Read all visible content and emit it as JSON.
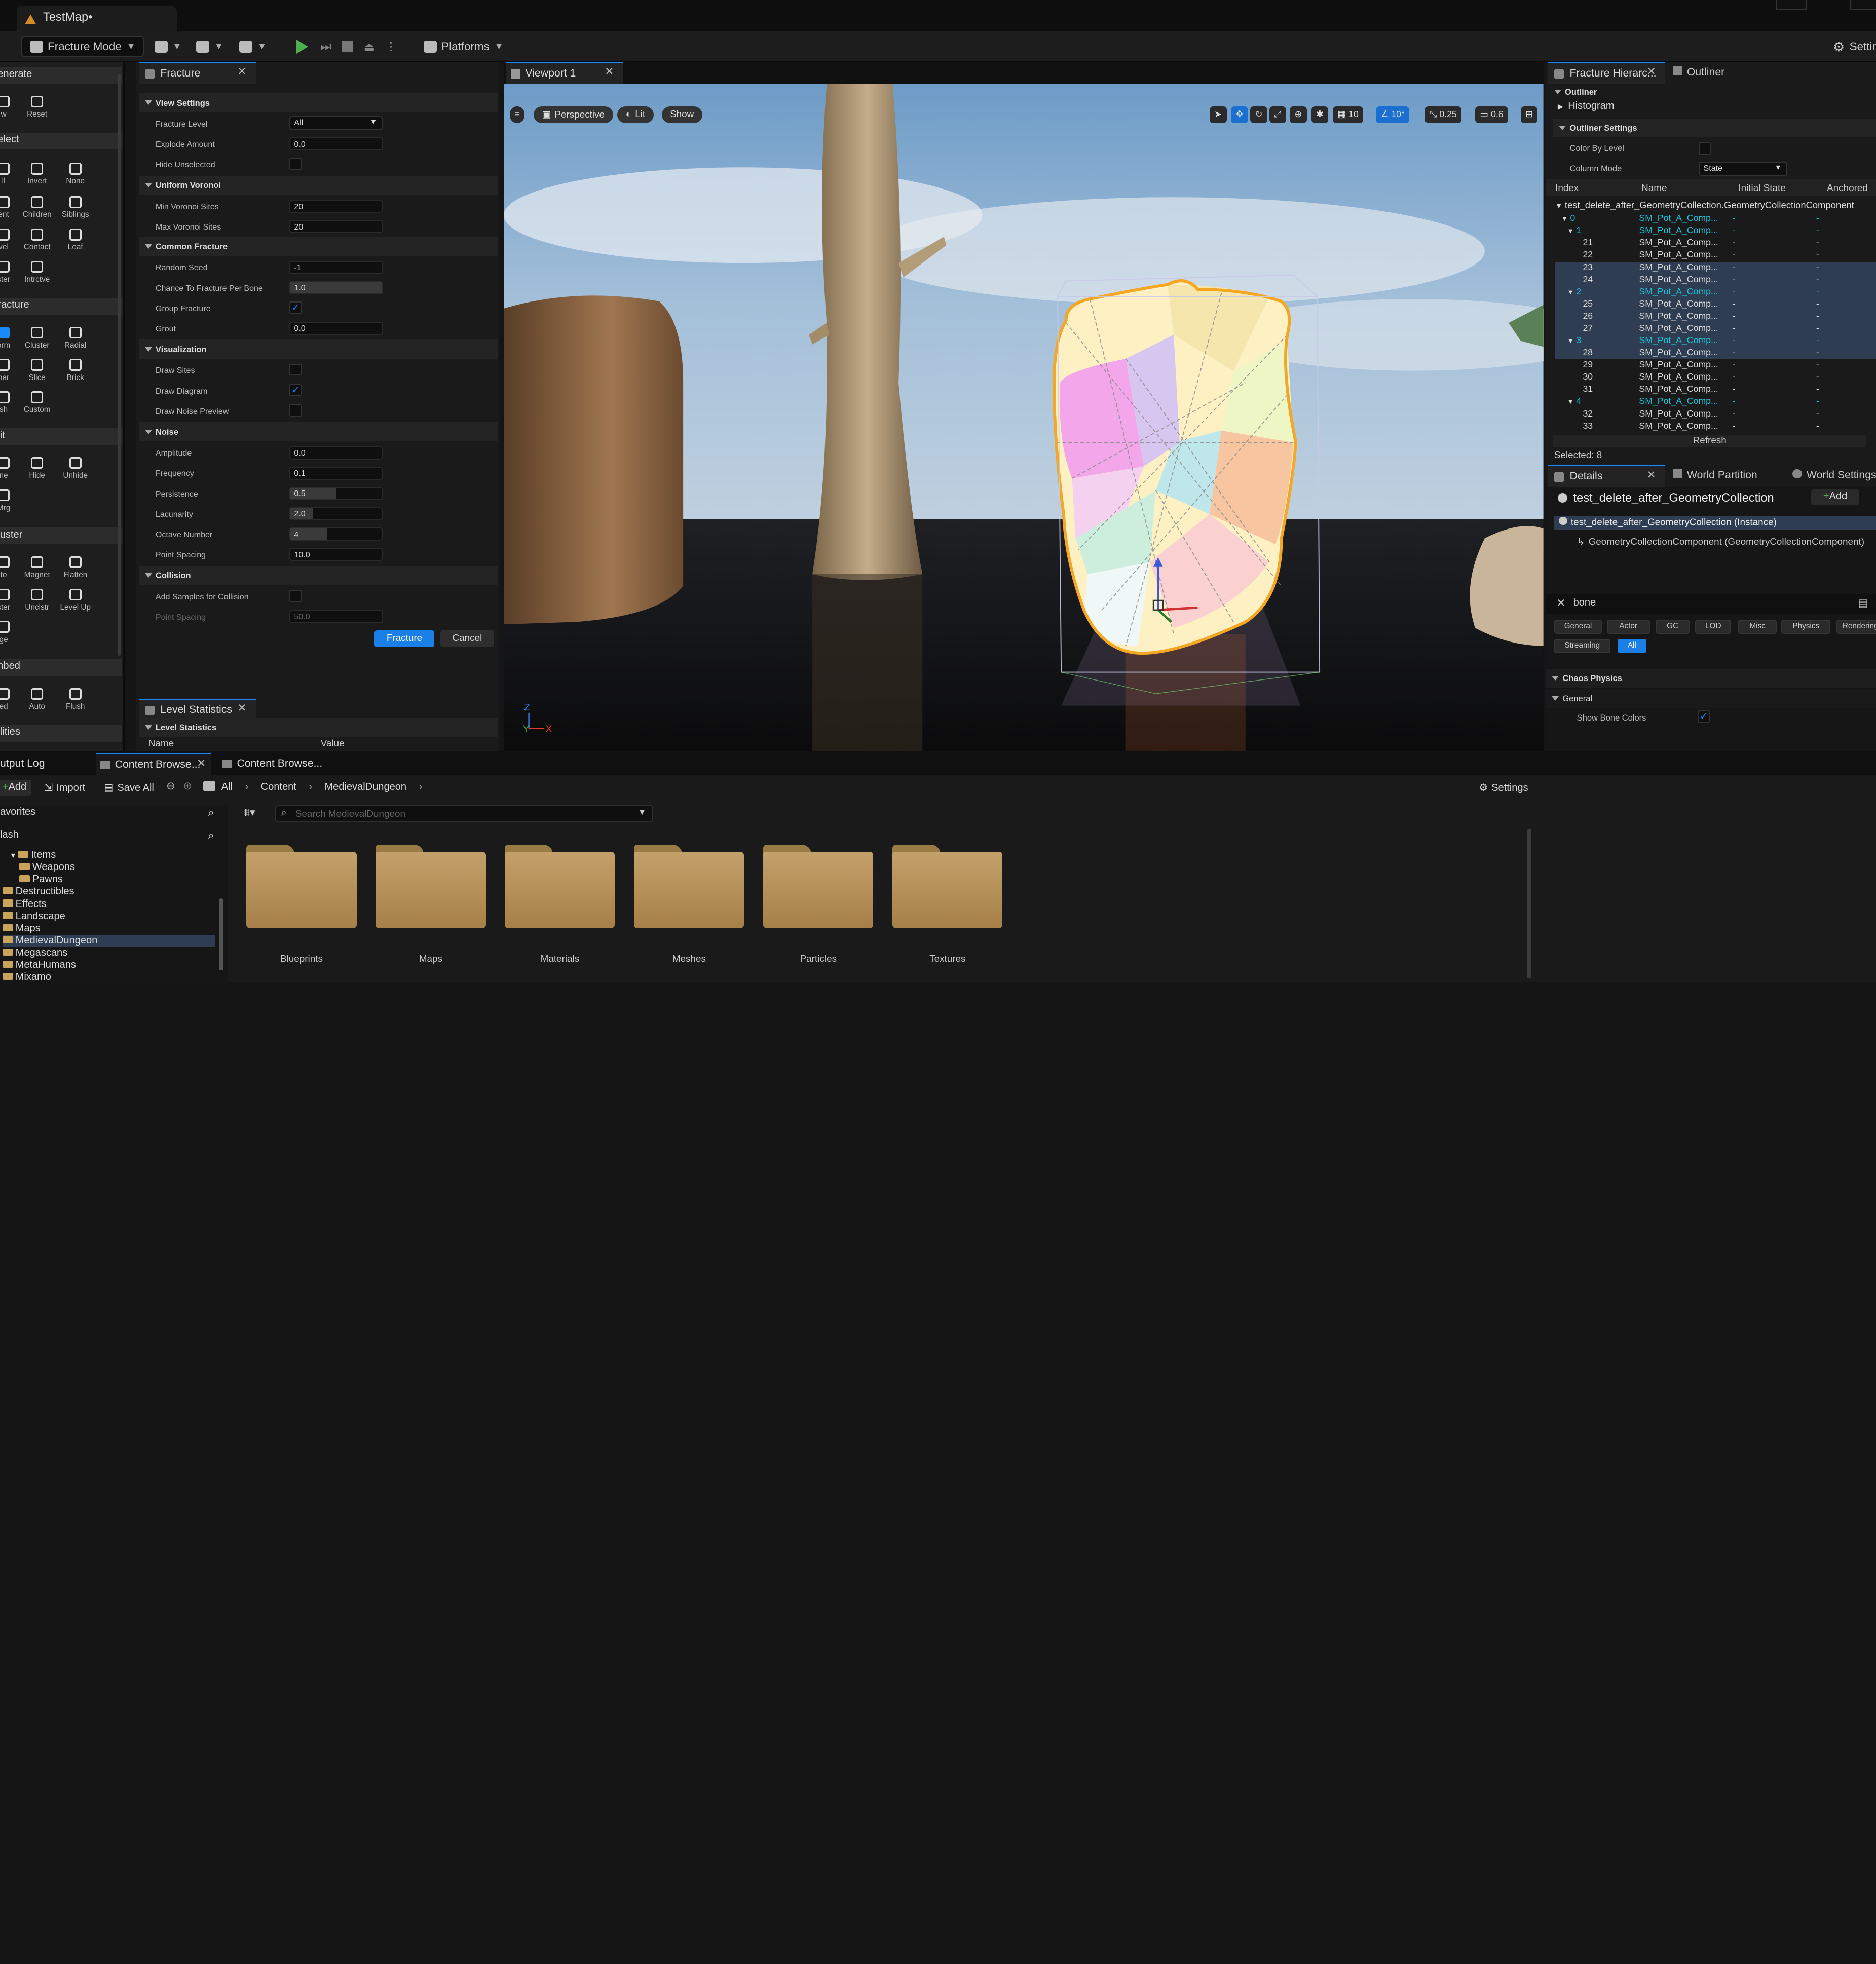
{
  "title_bar": {
    "map_tab": "TestMap•"
  },
  "toolbar": {
    "mode_label": "Fracture Mode",
    "platforms_label": "Platforms",
    "settings_label": "Settings"
  },
  "palette": {
    "sections": [
      "enerate",
      "elect",
      "racture",
      "lit",
      "luster",
      "nbed",
      "ilities"
    ],
    "generate_buttons": [
      "w",
      "Reset"
    ],
    "select_buttons": [
      "ll",
      "Invert",
      "None",
      "ent",
      "Children",
      "Siblings",
      "vel",
      "Contact",
      "Leaf",
      "ster",
      "Intrctve"
    ],
    "fracture_buttons": [
      "orm",
      "Cluster",
      "Radial",
      "nar",
      "Slice",
      "Brick",
      "sh",
      "Custom"
    ],
    "edit_buttons": [
      "ne",
      "Hide",
      "Unhide",
      "Mrg"
    ],
    "cluster_buttons": [
      "to",
      "Magnet",
      "Flatten",
      "ster",
      "Unclstr",
      "Level Up",
      "ge"
    ],
    "embed_buttons": [
      "ed",
      "Auto",
      "Flush"
    ]
  },
  "fracture_panel": {
    "tab": "Fracture",
    "sections": {
      "view": "View Settings",
      "voronoi": "Uniform Voronoi",
      "common": "Common Fracture",
      "visualization": "Visualization",
      "noise": "Noise",
      "collision": "Collision"
    },
    "rows": {
      "fracture_level": {
        "label": "Fracture Level",
        "value": "All"
      },
      "explode_amount": {
        "label": "Explode Amount",
        "value": "0.0"
      },
      "hide_unselected": {
        "label": "Hide Unselected"
      },
      "min_voronoi": {
        "label": "Min Voronoi Sites",
        "value": "20"
      },
      "max_voronoi": {
        "label": "Max Voronoi Sites",
        "value": "20"
      },
      "random_seed": {
        "label": "Random Seed",
        "value": "-1"
      },
      "chance": {
        "label": "Chance To Fracture Per Bone",
        "value": "1.0"
      },
      "group_fracture": {
        "label": "Group Fracture",
        "checked": true
      },
      "grout": {
        "label": "Grout",
        "value": "0.0"
      },
      "draw_sites": {
        "label": "Draw Sites"
      },
      "draw_diagram": {
        "label": "Draw Diagram",
        "checked": true
      },
      "draw_noise": {
        "label": "Draw Noise Preview"
      },
      "amplitude": {
        "label": "Amplitude",
        "value": "0.0"
      },
      "frequency": {
        "label": "Frequency",
        "value": "0.1"
      },
      "persistence": {
        "label": "Persistence",
        "value": "0.5",
        "fill": 0.5
      },
      "lacunarity": {
        "label": "Lacunarity",
        "value": "2.0",
        "fill": 0.25
      },
      "octave": {
        "label": "Octave Number",
        "value": "4",
        "fill": 0.4
      },
      "point_spacing": {
        "label": "Point Spacing",
        "value": "10.0"
      },
      "add_samples": {
        "label": "Add Samples for Collision"
      },
      "collision_spacing": {
        "label": "Point Spacing",
        "value": "50.0"
      }
    },
    "fracture_button": "Fracture",
    "cancel_button": "Cancel"
  },
  "level_stats": {
    "tab": "Level Statistics",
    "section": "Level Statistics",
    "col_name": "Name",
    "col_value": "Value"
  },
  "viewport": {
    "tab": "Viewport 1",
    "perspective": "Perspective",
    "lit": "Lit",
    "show": "Show",
    "grid_snap": "10",
    "rot_snap": "10°",
    "scale_snap": "0.25",
    "cam_speed": "0.6"
  },
  "fracture_hierarchy": {
    "tab": "Fracture Hierarc...",
    "outliner_tab": "Outliner",
    "outliner_section": "Outliner",
    "histogram": "Histogram",
    "outliner_settings": "Outliner Settings",
    "color_by_level": "Color By Level",
    "column_mode": "Column Mode",
    "column_mode_value": "State",
    "columns": [
      "Index",
      "Name",
      "Initial State",
      "Anchored"
    ],
    "root": "test_delete_after_GeometryCollection.GeometryCollectionComponent",
    "rows": [
      {
        "idx": "0",
        "name": "SM_Pot_A_Comp...",
        "state": "-",
        "anch": "-",
        "cluster": true,
        "sel": false,
        "ind": 1
      },
      {
        "idx": "1",
        "name": "SM_Pot_A_Comp...",
        "state": "-",
        "anch": "-",
        "cluster": true,
        "sel": false,
        "ind": 2
      },
      {
        "idx": "21",
        "name": "SM_Pot_A_Comp...",
        "state": "-",
        "anch": "-",
        "cluster": false,
        "sel": false,
        "ind": 3
      },
      {
        "idx": "22",
        "name": "SM_Pot_A_Comp...",
        "state": "-",
        "anch": "-",
        "cluster": false,
        "sel": false,
        "ind": 3
      },
      {
        "idx": "23",
        "name": "SM_Pot_A_Comp...",
        "state": "-",
        "anch": "-",
        "cluster": false,
        "sel": true,
        "ind": 3
      },
      {
        "idx": "24",
        "name": "SM_Pot_A_Comp...",
        "state": "-",
        "anch": "-",
        "cluster": false,
        "sel": true,
        "ind": 3
      },
      {
        "idx": "2",
        "name": "SM_Pot_A_Comp...",
        "state": "-",
        "anch": "-",
        "cluster": true,
        "sel": true,
        "ind": 2
      },
      {
        "idx": "25",
        "name": "SM_Pot_A_Comp...",
        "state": "-",
        "anch": "-",
        "cluster": false,
        "sel": true,
        "ind": 3
      },
      {
        "idx": "26",
        "name": "SM_Pot_A_Comp...",
        "state": "-",
        "anch": "-",
        "cluster": false,
        "sel": true,
        "ind": 3
      },
      {
        "idx": "27",
        "name": "SM_Pot_A_Comp...",
        "state": "-",
        "anch": "-",
        "cluster": false,
        "sel": true,
        "ind": 3
      },
      {
        "idx": "3",
        "name": "SM_Pot_A_Comp...",
        "state": "-",
        "anch": "-",
        "cluster": true,
        "sel": true,
        "ind": 2
      },
      {
        "idx": "28",
        "name": "SM_Pot_A_Comp...",
        "state": "-",
        "anch": "-",
        "cluster": false,
        "sel": true,
        "ind": 3
      },
      {
        "idx": "29",
        "name": "SM_Pot_A_Comp...",
        "state": "-",
        "anch": "-",
        "cluster": false,
        "sel": false,
        "ind": 3
      },
      {
        "idx": "30",
        "name": "SM_Pot_A_Comp...",
        "state": "-",
        "anch": "-",
        "cluster": false,
        "sel": false,
        "ind": 3
      },
      {
        "idx": "31",
        "name": "SM_Pot_A_Comp...",
        "state": "-",
        "anch": "-",
        "cluster": false,
        "sel": false,
        "ind": 3
      },
      {
        "idx": "4",
        "name": "SM_Pot_A_Comp...",
        "state": "-",
        "anch": "-",
        "cluster": true,
        "sel": false,
        "ind": 2
      },
      {
        "idx": "32",
        "name": "SM_Pot_A_Comp...",
        "state": "-",
        "anch": "-",
        "cluster": false,
        "sel": false,
        "ind": 3
      },
      {
        "idx": "33",
        "name": "SM_Pot_A_Comp...",
        "state": "-",
        "anch": "-",
        "cluster": false,
        "sel": false,
        "ind": 3
      }
    ],
    "refresh": "Refresh",
    "selected": "Selected: 8"
  },
  "details": {
    "tab": "Details",
    "world_partition_tab": "World Partition",
    "world_settings_tab": "World Settings",
    "object_name": "test_delete_after_GeometryCollection",
    "add_button": "Add",
    "instance_row": "test_delete_after_GeometryCollection (Instance)",
    "component_row": "GeometryCollectionComponent (GeometryCollectionComponent)",
    "search_value": "bone",
    "filters": [
      "General",
      "Actor",
      "GC",
      "LOD",
      "Misc",
      "Physics",
      "Rendering",
      "Streaming",
      "All"
    ],
    "chaos_physics": "Chaos Physics",
    "general": "General",
    "show_bone_colors": "Show Bone Colors"
  },
  "bottom": {
    "tabs": [
      "utput Log",
      "Content Browse...",
      "Content Browse..."
    ],
    "add": "Add",
    "import": "Import",
    "save_all": "Save All",
    "path": [
      "All",
      "Content",
      "MedievalDungeon"
    ],
    "settings": "Settings",
    "favorites": "avorites",
    "project": "lash",
    "search_placeholder": "Search MedievalDungeon",
    "tree": [
      "Items",
      "Weapons",
      "Pawns",
      "Destructibles",
      "Effects",
      "Landscape",
      "Maps",
      "MedievalDungeon",
      "Megascans",
      "MetaHumans",
      "Mixamo"
    ],
    "folders": [
      "Blueprints",
      "Maps",
      "Materials",
      "Meshes",
      "Particles",
      "Textures"
    ]
  },
  "colors": {
    "accent": "#1a8bff",
    "selection_outline": "#f5a623",
    "cluster_text": "#1fc3d9",
    "folder": "#b8925a"
  }
}
